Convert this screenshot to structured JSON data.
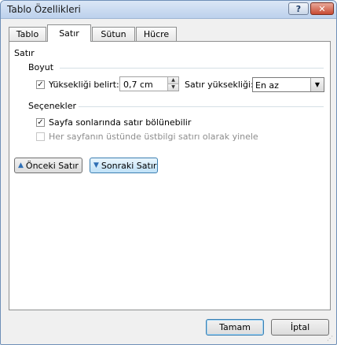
{
  "window": {
    "title": "Tablo Özellikleri",
    "help_label": "?",
    "close_label": "✕"
  },
  "tabs": [
    {
      "label": "Tablo",
      "active": false
    },
    {
      "label": "Satır",
      "active": true
    },
    {
      "label": "Sütun",
      "active": false
    },
    {
      "label": "Hücre",
      "active": false
    }
  ],
  "row_section": {
    "heading": "Satır",
    "size_heading": "Boyut",
    "specify_height": {
      "label": "Yüksekliği belirt:",
      "checked": true
    },
    "height_value": "0,7 cm",
    "row_height_label": "Satır yüksekliği:",
    "row_height_mode": "En az",
    "options_heading": "Seçenekler",
    "allow_break": {
      "label": "Sayfa sonlarında satır bölünebilir",
      "checked": true
    },
    "repeat_header": {
      "label": "Her sayfanın üstünde üstbilgi satırı olarak yinele",
      "checked": false,
      "disabled": true
    },
    "prev_row_button": "Önceki Satır",
    "next_row_button": "Sonraki Satır"
  },
  "footer": {
    "ok_label": "Tamam",
    "cancel_label": "İptal"
  },
  "colors": {
    "accent": "#3c7fb1",
    "title_bar": "#bcd1ec",
    "close_button": "#c84a32"
  },
  "icons": [
    "question-icon",
    "close-icon",
    "arrow-up-icon",
    "arrow-down-icon",
    "chevron-down-icon"
  ]
}
